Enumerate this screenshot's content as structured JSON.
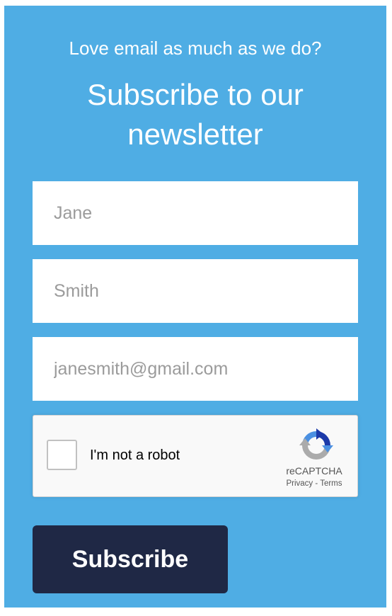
{
  "newsletter": {
    "kicker": "Love email as much as we do?",
    "headline": "Subscribe to our newsletter",
    "colors": {
      "panel_background": "#4fade4",
      "button_background": "#1f2845",
      "text": "#ffffff"
    }
  },
  "form": {
    "first_name": {
      "value": "",
      "placeholder": "Jane"
    },
    "last_name": {
      "value": "",
      "placeholder": "Smith"
    },
    "email": {
      "value": "",
      "placeholder": "janesmith@gmail.com"
    }
  },
  "recaptcha": {
    "checkbox_label": "I'm not a robot",
    "checked": false,
    "brand": "reCAPTCHA",
    "privacy_label": "Privacy",
    "separator": " - ",
    "terms_label": "Terms",
    "icon": "recaptcha-logo-icon"
  },
  "actions": {
    "subscribe_label": "Subscribe"
  }
}
